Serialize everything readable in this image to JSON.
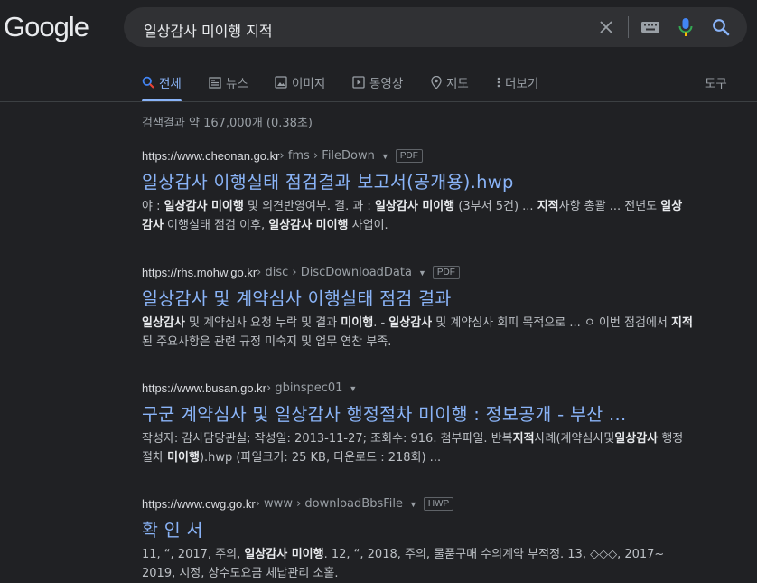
{
  "logo": "Google",
  "search": {
    "query": "일상감사 미이행 지적"
  },
  "tabs": [
    {
      "label": "전체",
      "icon": "search-icon",
      "active": true
    },
    {
      "label": "뉴스",
      "icon": "news-icon"
    },
    {
      "label": "이미지",
      "icon": "image-icon"
    },
    {
      "label": "동영상",
      "icon": "video-icon"
    },
    {
      "label": "지도",
      "icon": "map-pin-icon"
    },
    {
      "label": "더보기",
      "icon": "more-vert-icon"
    }
  ],
  "tools": "도구",
  "stats": "검색결과 약 167,000개 (0.38초)",
  "results": [
    {
      "domain": "https://www.cheonan.go.kr",
      "path": " › fms › FileDown",
      "badge": "PDF",
      "title": "일상감사 이행실태 점검결과 보고서(공개용).hwp",
      "snippet_html": "야 : <b>일상감사 미이행</b> 및 의견반영여부. 결. 과 : <b>일상감사 미이행</b> (3부서 5건) ... <b>지적</b>사항 총괄 ... 전년도 <b>일상감사</b> 이행실태 점검 이후, <b>일상감사 미이행</b> 사업이."
    },
    {
      "domain": "https://rhs.mohw.go.kr",
      "path": " › disc › DiscDownloadData",
      "badge": "PDF",
      "title": "일상감사 및 계약심사 이행실태 점검 결과",
      "snippet_html": "<b>일상감사</b> 및 계약심사 요청 누락 및 결과 <b>미이행</b>. - <b>일상감사</b> 및 계약심사 회피 목적으로 ... ㅇ 이번 점검에서 <b>지적</b>된 주요사항은 관련 규정 미숙지 및 업무 연찬 부족."
    },
    {
      "domain": "https://www.busan.go.kr",
      "path": " › gbinspec01",
      "badge": "",
      "title": "구군 계약심사 및 일상감사 행정절차 미이행 : 정보공개 - 부산 ...",
      "snippet_html": "작성자: 감사담당관실; 작성일: 2013-11-27; 조회수: 916. 첨부파일. 반복<b>지적</b>사례(계약심사및<b>일상감사</b> 행정절차 <b>미이행</b>).hwp (파일크기: 25 KB, 다운로드 : 218회) ..."
    },
    {
      "domain": "https://www.cwg.go.kr",
      "path": " › www › downloadBbsFile",
      "badge": "HWP",
      "title": "확 인 서",
      "snippet_html": "11, “, 2017, 주의, <b>일상감사 미이행</b>. 12, “, 2018, 주의, 물품구매 수의계약 부적정. 13, ◇◇◇, 2017~ 2019, 시정, 상수도요금 체납관리 소홀."
    }
  ],
  "colors": {
    "background": "#202124",
    "link": "#8ab4f8",
    "text": "#bdc1c6"
  }
}
